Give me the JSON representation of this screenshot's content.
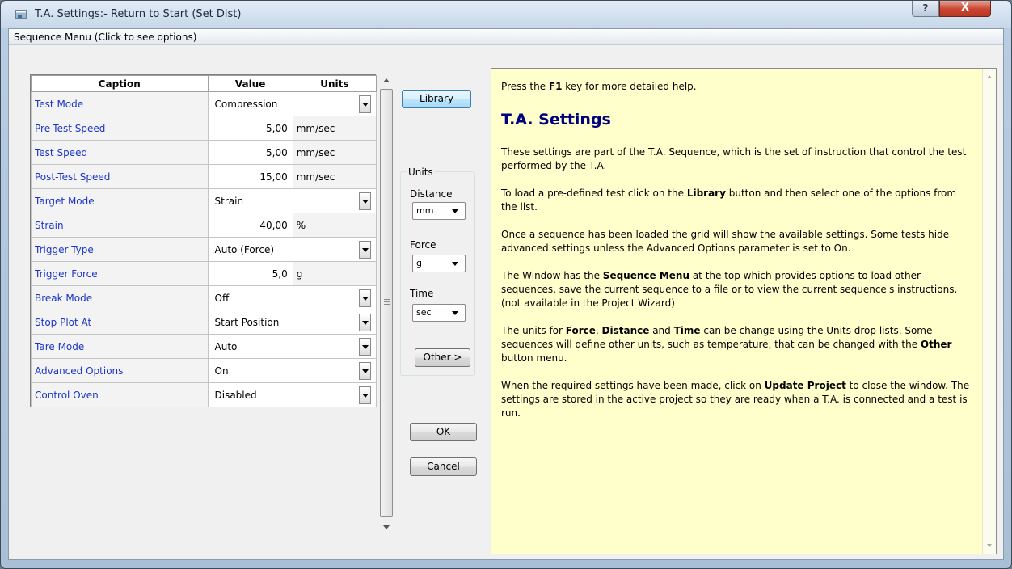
{
  "window": {
    "title": "T.A. Settings:- Return to Start (Set Dist)",
    "help_label": "?",
    "close_label": "X"
  },
  "menu": {
    "sequence_menu": "Sequence Menu (Click to see options)"
  },
  "grid": {
    "headers": {
      "caption": "Caption",
      "value": "Value",
      "units": "Units"
    },
    "rows": [
      {
        "caption": "Test Mode",
        "value": "Compression",
        "units": "",
        "type": "combo"
      },
      {
        "caption": "Pre-Test Speed",
        "value": "5,00",
        "units": "mm/sec",
        "type": "num"
      },
      {
        "caption": "Test Speed",
        "value": "5,00",
        "units": "mm/sec",
        "type": "num"
      },
      {
        "caption": "Post-Test Speed",
        "value": "15,00",
        "units": "mm/sec",
        "type": "num"
      },
      {
        "caption": "Target Mode",
        "value": "Strain",
        "units": "",
        "type": "combo"
      },
      {
        "caption": "Strain",
        "value": "40,00",
        "units": "%",
        "type": "num"
      },
      {
        "caption": "Trigger Type",
        "value": "Auto (Force)",
        "units": "",
        "type": "combo"
      },
      {
        "caption": "Trigger Force",
        "value": "5,0",
        "units": "g",
        "type": "num"
      },
      {
        "caption": "Break Mode",
        "value": "Off",
        "units": "",
        "type": "combo"
      },
      {
        "caption": "Stop Plot At",
        "value": "Start Position",
        "units": "",
        "type": "combo"
      },
      {
        "caption": "Tare Mode",
        "value": "Auto",
        "units": "",
        "type": "combo"
      },
      {
        "caption": "Advanced Options",
        "value": "On",
        "units": "",
        "type": "combo"
      },
      {
        "caption": "Control Oven",
        "value": "Disabled",
        "units": "",
        "type": "combo"
      }
    ]
  },
  "buttons": {
    "library": "Library",
    "other": "Other >",
    "ok": "OK",
    "cancel": "Cancel"
  },
  "units": {
    "group_label": "Units",
    "distance_label": "Distance",
    "distance_value": "mm",
    "force_label": "Force",
    "force_value": "g",
    "time_label": "Time",
    "time_value": "sec"
  },
  "help": {
    "intro_pre": "Press the ",
    "intro_key": "F1",
    "intro_post": " key for more detailed help.",
    "title": "T.A. Settings",
    "p1": "These settings are part of the T.A. Sequence, which is the set of instruction that control the test performed by the T.A.",
    "p2_pre": "To load a pre-defined test click on the ",
    "p2_bold": "Library",
    "p2_post": " button and then select one of the options from the list.",
    "p3": "Once a sequence has been loaded the grid will show the available settings. Some tests hide advanced settings unless the Advanced Options parameter is set to On.",
    "p4_pre": "The Window has the ",
    "p4_bold": "Sequence Menu",
    "p4_post": " at the top which provides options to load other sequences, save the current sequence to a file or to view the current sequence's instructions.",
    "p4_note": "(not available in the Project Wizard)",
    "p5_pre": "The units for ",
    "p5_b1": "Force",
    "p5_sep1": ", ",
    "p5_b2": "Distance",
    "p5_sep2": " and ",
    "p5_b3": "Time",
    "p5_mid": " can be change using the Units drop lists. Some sequences will define other units, such as temperature, that can be changed with the ",
    "p5_b4": "Other",
    "p5_post": " button menu.",
    "p6_pre": "When the required settings have been made, click on ",
    "p6_bold": "Update Project",
    "p6_post": " to close the window. The settings are stored in the active project so they are ready when a T.A. is connected and a test is run."
  }
}
